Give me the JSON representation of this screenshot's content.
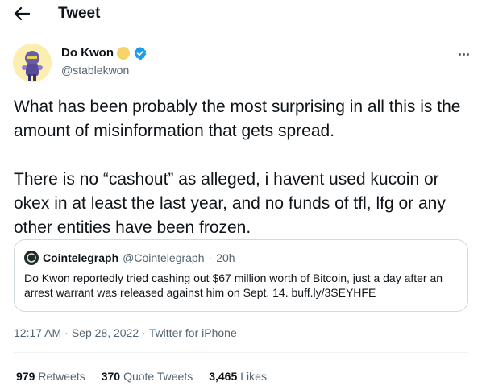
{
  "header": {
    "title": "Tweet"
  },
  "author": {
    "name": "Do Kwon",
    "handle": "@stablekwon"
  },
  "tweet": {
    "paragraphs": [
      "What has been probably the most surprising in all this is the amount of misinformation that gets spread.",
      "There is no “cashout” as alleged, i havent used kucoin or okex in at least the last year, and no funds of tfl, lfg or any other entities have been frozen."
    ]
  },
  "quote": {
    "name": "Cointelegraph",
    "handle": "@Cointelegraph",
    "separator": "·",
    "time": "20h",
    "text": "Do Kwon reportedly tried cashing out $67 million worth of Bitcoin, just a day after an arrest warrant was released against him on Sept. 14. buff.ly/3SEYHFE"
  },
  "meta": {
    "time": "12:17 AM",
    "sep1": "·",
    "date": "Sep 28, 2022",
    "sep2": "·",
    "source": "Twitter for iPhone"
  },
  "stats": {
    "retweets": {
      "count": "979",
      "label": "Retweets"
    },
    "quotes": {
      "count": "370",
      "label": "Quote Tweets"
    },
    "likes": {
      "count": "3,465",
      "label": "Likes"
    }
  },
  "colors": {
    "text": "#0f1419",
    "secondary": "#536471",
    "border": "#cfd9de",
    "verified": "#1d9bf0"
  },
  "icons": {
    "back": "arrow-left-icon",
    "verified": "verified-badge-icon",
    "more": "more-horizontal-icon"
  }
}
